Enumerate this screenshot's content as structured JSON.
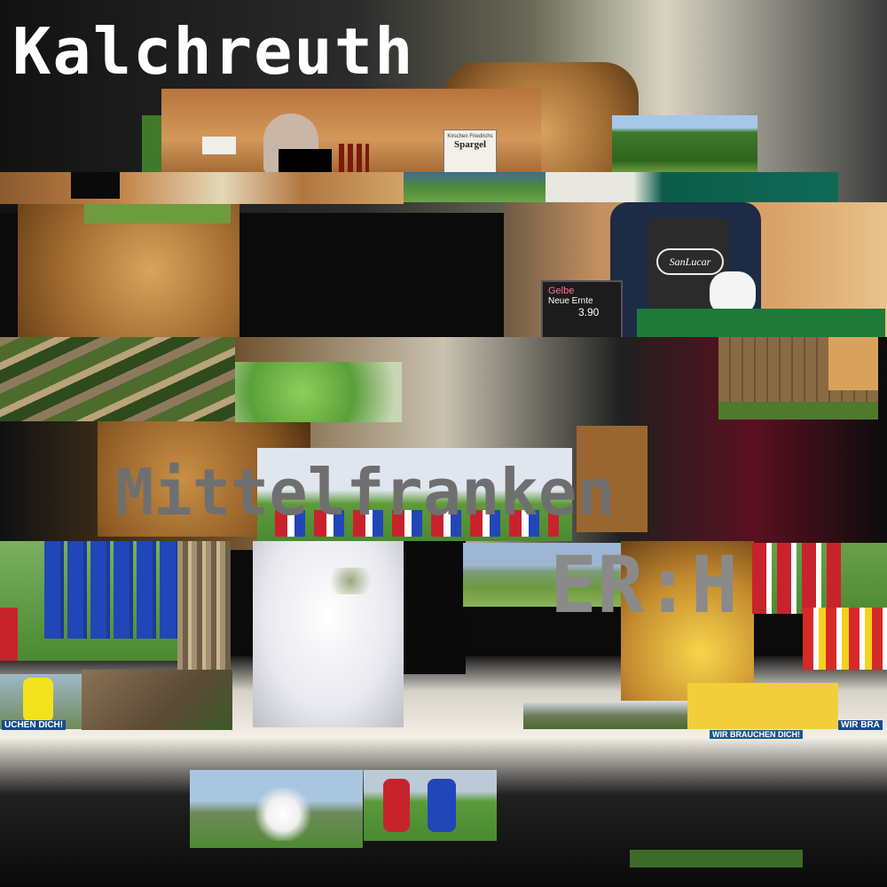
{
  "title_top": "Kalchreuth",
  "title_middle": "Mittelfranken",
  "title_code": "ER:H",
  "stand_sign_top": "Kirschen Friedrichs",
  "stand_sign_main": "Spargel",
  "apron_brand": "SanLucar",
  "chalk_sign_line1": "Gelbe",
  "chalk_sign_line2": "Neue Ernte",
  "chalk_price": "3.90",
  "banner_left": "UCHEN DICH!",
  "banner_mid": "WIR BRAUCHEN DICH!",
  "banner_right": "WIR BRA",
  "colors": {
    "pitch_green": "#3f7a2c",
    "wood": "#c58a4f",
    "team_blue": "#2146b8",
    "team_red": "#c8232d",
    "pastry": "#b07a3a",
    "title_white": "#ffffff",
    "title_gray": "#7a7a7a"
  }
}
